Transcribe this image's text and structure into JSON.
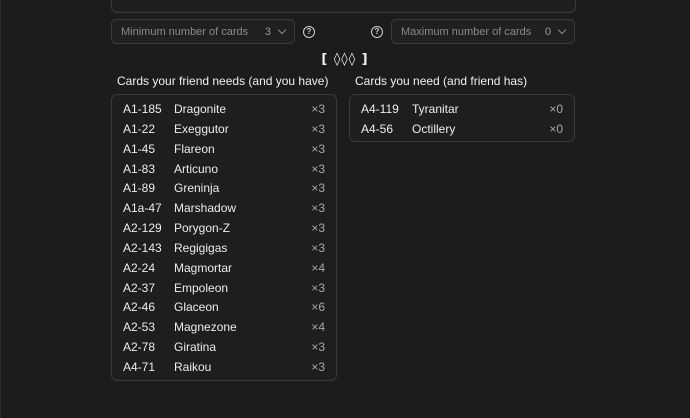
{
  "filters": {
    "min": {
      "label": "Minimum number of cards",
      "value": "3"
    },
    "max": {
      "label": "Maximum number of cards",
      "value": "0"
    },
    "help_glyph": "?"
  },
  "trade_code": "[ ◊◊◊ ]",
  "friend_needs": {
    "heading": "Cards your friend needs (and you have)",
    "cards": [
      {
        "id": "A1-185",
        "name": "Dragonite",
        "qty": "×3"
      },
      {
        "id": "A1-22",
        "name": "Exeggutor",
        "qty": "×3"
      },
      {
        "id": "A1-45",
        "name": "Flareon",
        "qty": "×3"
      },
      {
        "id": "A1-83",
        "name": "Articuno",
        "qty": "×3"
      },
      {
        "id": "A1-89",
        "name": "Greninja",
        "qty": "×3"
      },
      {
        "id": "A1a-47",
        "name": "Marshadow",
        "qty": "×3"
      },
      {
        "id": "A2-129",
        "name": "Porygon-Z",
        "qty": "×3"
      },
      {
        "id": "A2-143",
        "name": "Regigigas",
        "qty": "×3"
      },
      {
        "id": "A2-24",
        "name": "Magmortar",
        "qty": "×4"
      },
      {
        "id": "A2-37",
        "name": "Empoleon",
        "qty": "×3"
      },
      {
        "id": "A2-46",
        "name": "Glaceon",
        "qty": "×6"
      },
      {
        "id": "A2-53",
        "name": "Magnezone",
        "qty": "×4"
      },
      {
        "id": "A2-78",
        "name": "Giratina",
        "qty": "×3"
      },
      {
        "id": "A4-71",
        "name": "Raikou",
        "qty": "×3"
      }
    ]
  },
  "you_need": {
    "heading": "Cards you need (and friend has)",
    "cards": [
      {
        "id": "A4-119",
        "name": "Tyranitar",
        "qty": "×0"
      },
      {
        "id": "A4-56",
        "name": "Octillery",
        "qty": "×0"
      }
    ]
  }
}
